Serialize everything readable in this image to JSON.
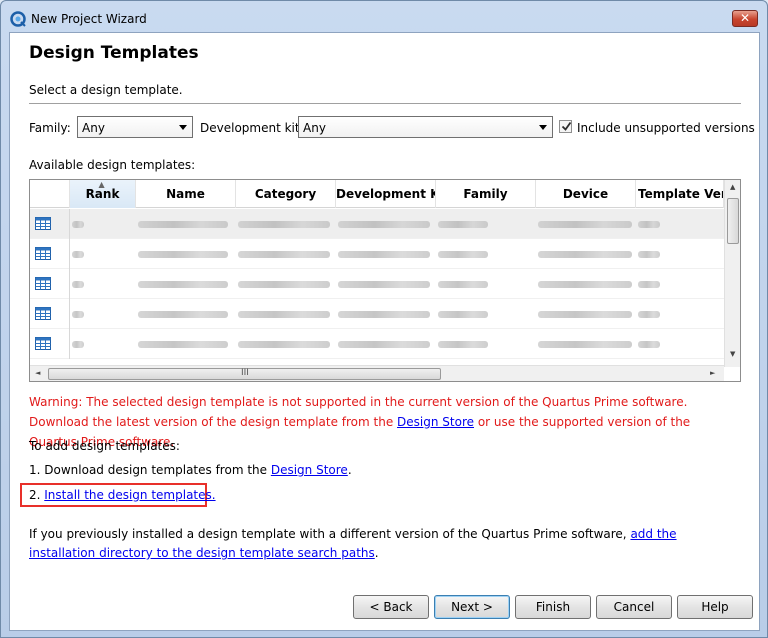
{
  "window": {
    "title": "New Project Wizard",
    "close_label": "✕"
  },
  "page": {
    "heading": "Design Templates",
    "subtext": "Select a design template."
  },
  "filters": {
    "family_label": "Family:",
    "family_value": "Any",
    "devkit_label": "Development kit:",
    "devkit_value": "Any",
    "unsupported_label": "Include unsupported versions",
    "unsupported_checked": true
  },
  "table": {
    "label": "Available design templates:",
    "columns": [
      "Rank",
      "Name",
      "Category",
      "Development Kit",
      "Family",
      "Device",
      "Template Versi"
    ],
    "sorted_column": "Rank",
    "row_count_visible": 5,
    "scroll_grip": "III"
  },
  "warning": {
    "part1": "Warning: The selected design template is not supported in the current version of the Quartus Prime software. Download the latest version of the design template from the ",
    "link": "Design Store",
    "part2": " or use the supported version of the Quartus Prime software."
  },
  "instructions": {
    "intro": "To add design templates:",
    "step1_prefix": "1. Download design templates from the ",
    "step1_link": "Design Store",
    "step1_suffix": ".",
    "step2_prefix": "2. ",
    "step2_link": "Install the design templates.",
    "previous_prefix": "If you previously installed a design template with a different version of the Quartus Prime software, ",
    "previous_link": "add the installation directory to the design template search paths",
    "previous_suffix": "."
  },
  "buttons": {
    "back": "< Back",
    "next": "Next >",
    "finish": "Finish",
    "cancel": "Cancel",
    "help": "Help"
  },
  "colors": {
    "warning": "#e11a1a",
    "link": "#0000ee",
    "highlight": "#e8302a"
  }
}
